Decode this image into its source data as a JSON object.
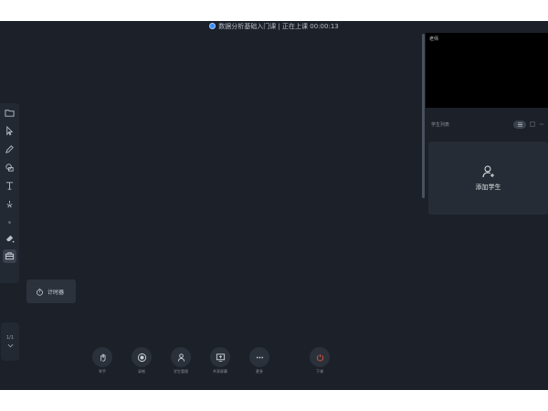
{
  "topbar": {
    "title": "数据分析基础入门课 | 正在上课 00:00:13"
  },
  "toolbar": {
    "tools": [
      {
        "name": "folder-icon"
      },
      {
        "name": "cursor-icon"
      },
      {
        "name": "pen-icon"
      },
      {
        "name": "shape-icon"
      },
      {
        "name": "text-icon"
      },
      {
        "name": "laser-icon"
      },
      {
        "name": "eraser-icon"
      },
      {
        "name": "toolbox-icon"
      }
    ]
  },
  "timer_popup": {
    "label": "计时器"
  },
  "pager": {
    "text": "1/1"
  },
  "video": {
    "label": "老师"
  },
  "panel": {
    "title": "学生列表"
  },
  "add_student": {
    "label": "添加学生"
  },
  "bottom": {
    "buttons": [
      {
        "label": "举手"
      },
      {
        "label": "录制"
      },
      {
        "label": "学生管理"
      },
      {
        "label": "共享屏幕"
      },
      {
        "label": "更多"
      },
      {
        "label": "下课"
      }
    ]
  },
  "colors": {
    "background": "#1b2029",
    "accent": "#3a8ef6",
    "end": "#d8533f"
  }
}
